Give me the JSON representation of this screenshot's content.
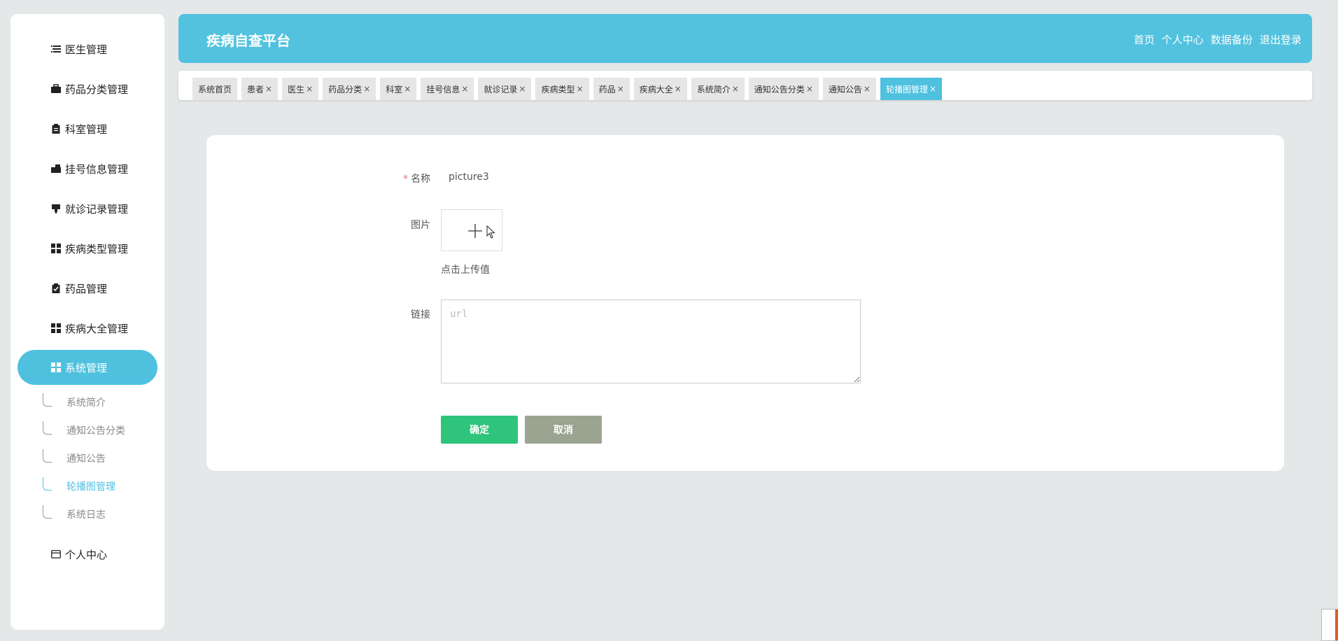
{
  "colors": {
    "accent": "#4fc1df",
    "header": "#52c2df",
    "confirm": "#2fc47b",
    "cancel": "#9ba491",
    "required": "#f56c6c"
  },
  "sidebar": {
    "items": [
      {
        "label": "医生管理",
        "icon": "list-icon"
      },
      {
        "label": "药品分类管理",
        "icon": "briefcase-icon"
      },
      {
        "label": "科室管理",
        "icon": "clipboard-icon"
      },
      {
        "label": "挂号信息管理",
        "icon": "ticket-icon"
      },
      {
        "label": "就诊记录管理",
        "icon": "pin-icon"
      },
      {
        "label": "疾病类型管理",
        "icon": "grid-icon"
      },
      {
        "label": "药品管理",
        "icon": "clipboard-check-icon"
      },
      {
        "label": "疾病大全管理",
        "icon": "grid-icon"
      },
      {
        "label": "系统管理",
        "icon": "grid-icon",
        "active": true
      }
    ],
    "sub_items": [
      {
        "label": "系统简介"
      },
      {
        "label": "通知公告分类"
      },
      {
        "label": "通知公告"
      },
      {
        "label": "轮播图管理",
        "active": true
      },
      {
        "label": "系统日志"
      }
    ],
    "personal": {
      "label": "个人中心",
      "icon": "card-icon"
    }
  },
  "header": {
    "title": "疾病自查平台",
    "nav": [
      "首页",
      "个人中心",
      "数据备份",
      "退出登录"
    ]
  },
  "tabs": [
    {
      "label": "系统首页",
      "closable": false
    },
    {
      "label": "患者",
      "closable": true
    },
    {
      "label": "医生",
      "closable": true
    },
    {
      "label": "药品分类",
      "closable": true
    },
    {
      "label": "科室",
      "closable": true
    },
    {
      "label": "挂号信息",
      "closable": true
    },
    {
      "label": "就诊记录",
      "closable": true
    },
    {
      "label": "疾病类型",
      "closable": true
    },
    {
      "label": "药品",
      "closable": true
    },
    {
      "label": "疾病大全",
      "closable": true
    },
    {
      "label": "系统简介",
      "closable": true
    },
    {
      "label": "通知公告分类",
      "closable": true
    },
    {
      "label": "通知公告",
      "closable": true
    },
    {
      "label": "轮播图管理",
      "closable": true,
      "active": true
    }
  ],
  "tab_close_glyph": "×",
  "form": {
    "name_label": "名称",
    "required_mark": "*",
    "name_value": "picture3",
    "image_label": "图片",
    "upload_hint": "点击上传值",
    "link_label": "链接",
    "link_placeholder": "url",
    "link_value": "",
    "confirm_label": "确定",
    "cancel_label": "取消"
  }
}
